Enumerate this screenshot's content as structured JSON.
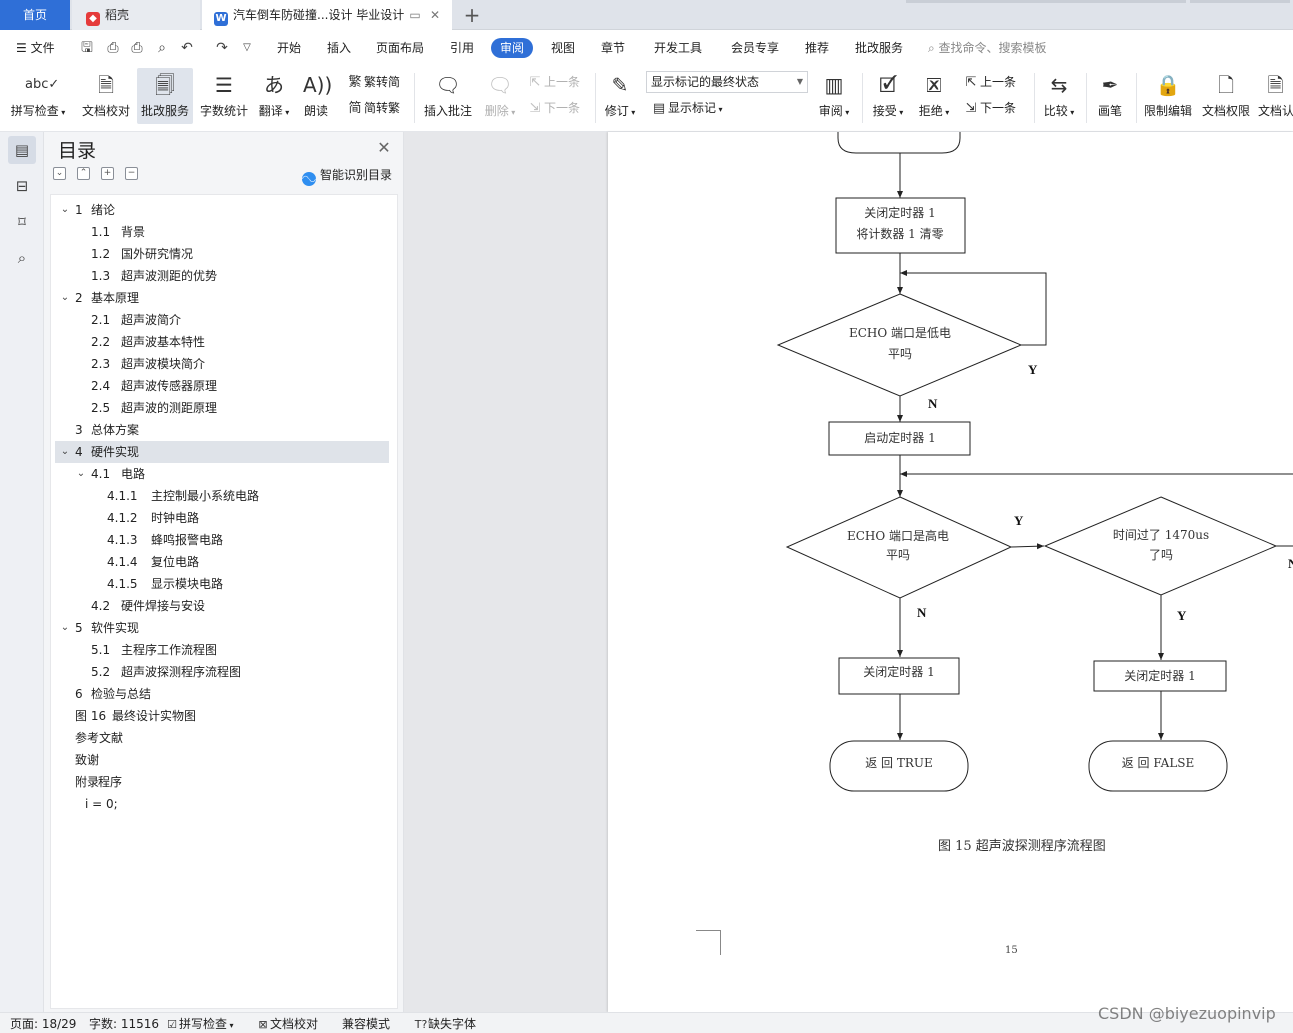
{
  "tabs": {
    "home": "首页",
    "daoke": "稻壳",
    "doc": "汽车倒车防碰撞...设计 毕业设计"
  },
  "menu": {
    "file": "文件",
    "items": [
      "开始",
      "插入",
      "页面布局",
      "引用",
      "审阅",
      "视图",
      "章节",
      "开发工具",
      "会员专享",
      "推荐",
      "批改服务"
    ],
    "active": "审阅",
    "search_placeholder": "查找命令、搜索模板"
  },
  "ribbon": {
    "spell_check": "拼写检查",
    "doc_proof": "文档校对",
    "review_service": "批改服务",
    "word_count": "字数统计",
    "translate": "翻译",
    "read_aloud": "朗读",
    "trad_to_simp": "繁转简",
    "simp_to_trad": "简转繁",
    "insert_comment": "插入批注",
    "delete": "删除",
    "prev_item": "上一条",
    "next_item": "下一条",
    "revise": "修订",
    "markup_state": "显示标记的最终状态",
    "show_markup": "显示标记",
    "review_pane": "审阅",
    "accept": "接受",
    "reject": "拒绝",
    "prev_change": "上一条",
    "next_change": "下一条",
    "compare": "比较",
    "pen": "画笔",
    "restrict_edit": "限制编辑",
    "doc_permission": "文档权限",
    "doc_cert": "文档认"
  },
  "toc": {
    "title": "目录",
    "smart_label": "智能识别目录",
    "items": [
      {
        "num": "1",
        "text": "绪论",
        "level": 1,
        "arrow": "⌄"
      },
      {
        "num": "1.1",
        "text": "背景",
        "level": 2,
        "arrow": ""
      },
      {
        "num": "1.2",
        "text": "国外研究情况",
        "level": 2,
        "arrow": ""
      },
      {
        "num": "1.3",
        "text": "超声波测距的优势",
        "level": 2,
        "arrow": ""
      },
      {
        "num": "2",
        "text": "基本原理",
        "level": 1,
        "arrow": "⌄"
      },
      {
        "num": "2.1",
        "text": "超声波简介",
        "level": 2,
        "arrow": ""
      },
      {
        "num": "2.2",
        "text": "超声波基本特性",
        "level": 2,
        "arrow": ""
      },
      {
        "num": "2.3",
        "text": "超声波模块简介",
        "level": 2,
        "arrow": ""
      },
      {
        "num": "2.4",
        "text": "超声波传感器原理",
        "level": 2,
        "arrow": ""
      },
      {
        "num": "2.5",
        "text": "超声波的测距原理",
        "level": 2,
        "arrow": ""
      },
      {
        "num": "3",
        "text": "总体方案",
        "level": 1,
        "arrow": ""
      },
      {
        "num": "4",
        "text": "硬件实现",
        "level": 1,
        "arrow": "⌄",
        "selected": true
      },
      {
        "num": "4.1",
        "text": "电路",
        "level": 2,
        "arrow": "⌄"
      },
      {
        "num": "4.1.1",
        "text": "主控制最小系统电路",
        "level": 3,
        "arrow": ""
      },
      {
        "num": "4.1.2",
        "text": "时钟电路",
        "level": 3,
        "arrow": ""
      },
      {
        "num": "4.1.3",
        "text": "蜂鸣报警电路",
        "level": 3,
        "arrow": ""
      },
      {
        "num": "4.1.4",
        "text": "复位电路",
        "level": 3,
        "arrow": ""
      },
      {
        "num": "4.1.5",
        "text": "显示模块电路",
        "level": 3,
        "arrow": ""
      },
      {
        "num": "4.2",
        "text": "硬件焊接与安设",
        "level": 2,
        "arrow": ""
      },
      {
        "num": "5",
        "text": "软件实现",
        "level": 1,
        "arrow": "⌄"
      },
      {
        "num": "5.1",
        "text": "主程序工作流程图",
        "level": 2,
        "arrow": ""
      },
      {
        "num": "5.2",
        "text": "超声波探测程序流程图",
        "level": 2,
        "arrow": ""
      },
      {
        "num": "6",
        "text": "检验与总结",
        "level": 1,
        "arrow": ""
      },
      {
        "num": "图 16",
        "text": "最终设计实物图",
        "level": 1,
        "arrow": ""
      },
      {
        "num": "",
        "text": "参考文献",
        "level": 1,
        "arrow": ""
      },
      {
        "num": "",
        "text": "致谢",
        "level": 1,
        "arrow": ""
      },
      {
        "num": "附录",
        "text": "程序",
        "level": 1,
        "arrow": ""
      },
      {
        "num": "",
        "text": "i = 0;",
        "level": 1.5,
        "arrow": ""
      }
    ]
  },
  "flowchart": {
    "box1_line1": "关闭定时器 1",
    "box1_line2": "将计数器 1 清零",
    "d1_line1": "ECHO 端口是低电",
    "d1_line2": "平吗",
    "yes": "Y",
    "no": "N",
    "box_start_timer": "启动定时器 1",
    "d2_line1": "ECHO 端口是高电",
    "d2_line2": "平吗",
    "d3_line1": "时间过了 1470us",
    "d3_line2": "了吗",
    "box_close_left": "关闭定时器 1",
    "box_close_right": "关闭定时器 1",
    "return_true": "返 回 TRUE",
    "return_false": "返 回 FALSE",
    "caption": "图 15  超声波探测程序流程图",
    "page_number": "15"
  },
  "status": {
    "page": "页面: 18/29",
    "words": "字数: 11516",
    "spell": "拼写检查",
    "proof": "文档校对",
    "compat": "兼容模式",
    "missing_font": "缺失字体"
  },
  "watermark": "CSDN @biyezuopinvip"
}
